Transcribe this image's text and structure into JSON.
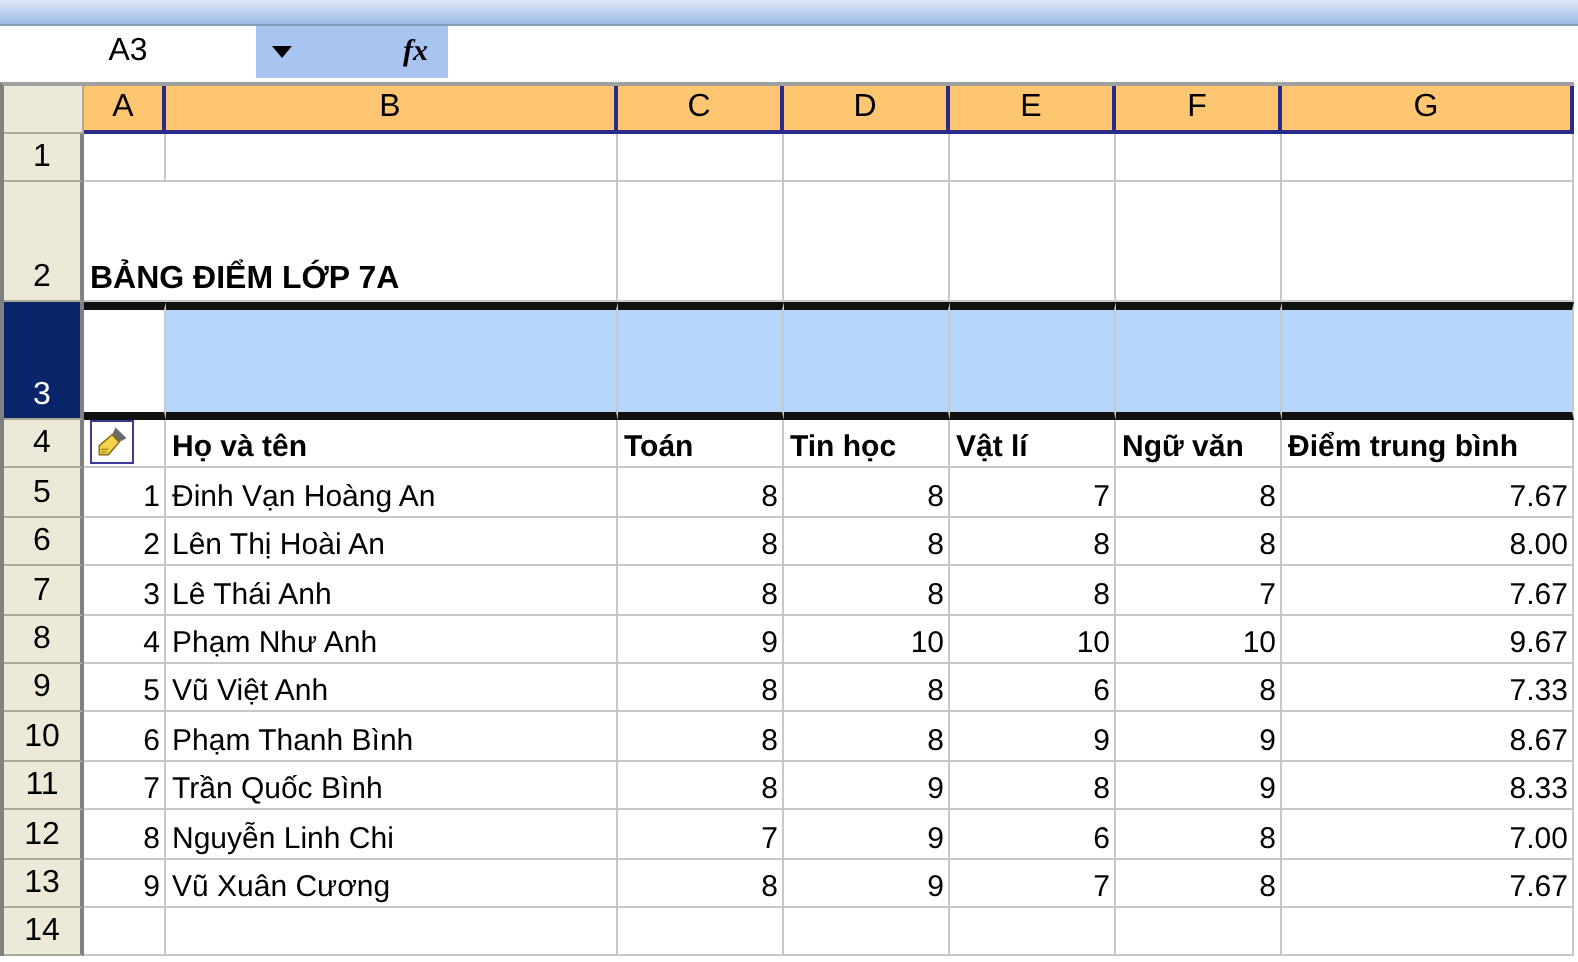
{
  "name_box": "A3",
  "function_label": "fx",
  "columns": [
    {
      "label": "A",
      "selected": true
    },
    {
      "label": "B",
      "selected": true
    },
    {
      "label": "C",
      "selected": true
    },
    {
      "label": "D",
      "selected": true
    },
    {
      "label": "E",
      "selected": true
    },
    {
      "label": "F",
      "selected": true
    },
    {
      "label": "G",
      "selected": true
    }
  ],
  "rows": [
    {
      "label": "1",
      "kind": "blank",
      "selected": false
    },
    {
      "label": "2",
      "kind": "title",
      "selected": false,
      "title": "BẢNG ĐIỂM LỚP 7A"
    },
    {
      "label": "3",
      "kind": "blank",
      "selected": true
    },
    {
      "label": "4",
      "kind": "header",
      "selected": false,
      "cells": {
        "B": "Họ và tên",
        "C": "Toán",
        "D": "Tin học",
        "E": "Vật lí",
        "F": "Ngữ văn",
        "G": "Điểm trung bình"
      }
    },
    {
      "label": "5",
      "kind": "data",
      "selected": false,
      "cells": {
        "A": "1",
        "B": "Đinh Vạn Hoàng An",
        "C": "8",
        "D": "8",
        "E": "7",
        "F": "8",
        "G": "7.67"
      }
    },
    {
      "label": "6",
      "kind": "data",
      "selected": false,
      "cells": {
        "A": "2",
        "B": "Lên Thị Hoài An",
        "C": "8",
        "D": "8",
        "E": "8",
        "F": "8",
        "G": "8.00"
      }
    },
    {
      "label": "7",
      "kind": "data",
      "selected": false,
      "cells": {
        "A": "3",
        "B": "Lê Thái Anh",
        "C": "8",
        "D": "8",
        "E": "8",
        "F": "7",
        "G": "7.67"
      }
    },
    {
      "label": "8",
      "kind": "data",
      "selected": false,
      "cells": {
        "A": "4",
        "B": "Phạm Như Anh",
        "C": "9",
        "D": "10",
        "E": "10",
        "F": "10",
        "G": "9.67"
      }
    },
    {
      "label": "9",
      "kind": "data",
      "selected": false,
      "cells": {
        "A": "5",
        "B": "Vũ Việt Anh",
        "C": "8",
        "D": "8",
        "E": "6",
        "F": "8",
        "G": "7.33"
      }
    },
    {
      "label": "10",
      "kind": "data",
      "selected": false,
      "cells": {
        "A": "6",
        "B": "Phạm Thanh Bình",
        "C": "8",
        "D": "8",
        "E": "9",
        "F": "9",
        "G": "8.67"
      }
    },
    {
      "label": "11",
      "kind": "data",
      "selected": false,
      "cells": {
        "A": "7",
        "B": "Trần Quốc Bình",
        "C": "8",
        "D": "9",
        "E": "8",
        "F": "9",
        "G": "8.33"
      }
    },
    {
      "label": "12",
      "kind": "data",
      "selected": false,
      "cells": {
        "A": "8",
        "B": "Nguyễn Linh Chi",
        "C": "7",
        "D": "9",
        "E": "6",
        "F": "8",
        "G": "7.00"
      }
    },
    {
      "label": "13",
      "kind": "data",
      "selected": false,
      "cells": {
        "A": "9",
        "B": "Vũ Xuân Cương",
        "C": "8",
        "D": "9",
        "E": "7",
        "F": "8",
        "G": "7.67"
      }
    },
    {
      "label": "14",
      "kind": "blank",
      "selected": false
    }
  ]
}
